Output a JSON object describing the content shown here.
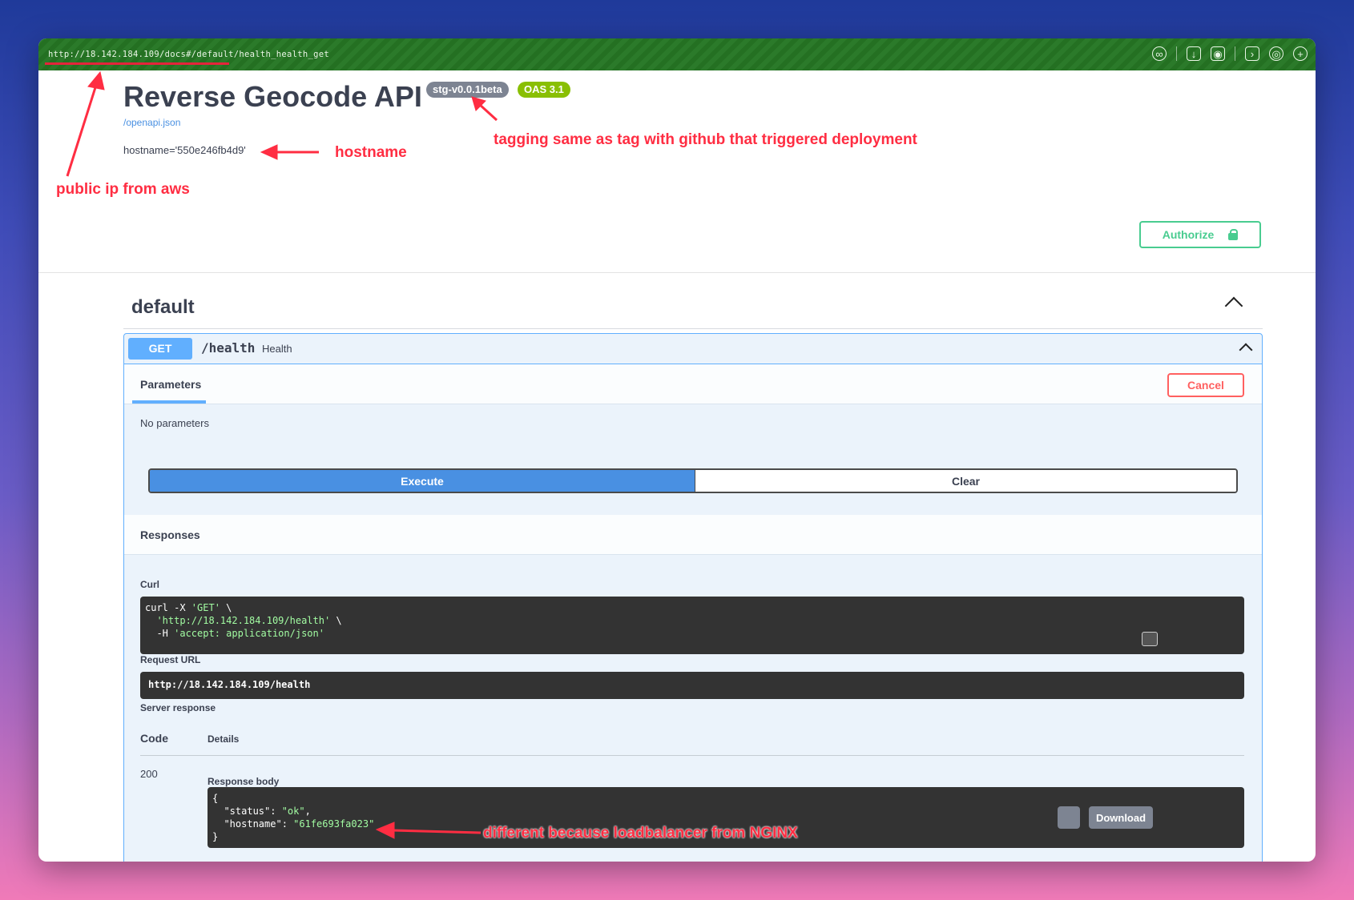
{
  "browser": {
    "url": "http://18.142.184.109/docs#/default/health_health_get"
  },
  "api": {
    "title": "Reverse Geocode API",
    "version_badge": "stg-v0.0.1beta",
    "oas_badge": "OAS 3.1",
    "openapi_link": "/openapi.json",
    "hostname": "hostname='550e246fb4d9'",
    "authorize_label": "Authorize"
  },
  "section": {
    "name": "default"
  },
  "operation": {
    "method": "GET",
    "path": "/health",
    "summary": "Health",
    "tab_parameters": "Parameters",
    "cancel_label": "Cancel",
    "no_parameters": "No parameters",
    "execute_label": "Execute",
    "clear_label": "Clear",
    "responses_label": "Responses",
    "curl_label": "Curl",
    "curl_line1": "curl -X ",
    "curl_line1_str": "'GET'",
    "curl_line1_end": " \\",
    "curl_line2_str": "'http://18.142.184.109/health'",
    "curl_line2_end": " \\",
    "curl_line3": "  -H ",
    "curl_line3_str": "'accept: application/json'",
    "request_url_label": "Request URL",
    "request_url": "http://18.142.184.109/health",
    "server_response_label": "Server response",
    "code_header": "Code",
    "details_header": "Details",
    "code": "200",
    "response_body_label": "Response body",
    "body_open": "{",
    "body_status_key": "\"status\"",
    "body_status_val": "\"ok\"",
    "body_hostname_key": "\"hostname\"",
    "body_hostname_val": "\"61fe693fa023\"",
    "body_close": "}",
    "download_label": "Download"
  },
  "annotations": {
    "public_ip": "public ip from aws",
    "hostname": "hostname",
    "tagging": "tagging same as tag with github that triggered deployment",
    "different": "different because loadbalancer from NGINX",
    "color": "#ff2d42"
  }
}
